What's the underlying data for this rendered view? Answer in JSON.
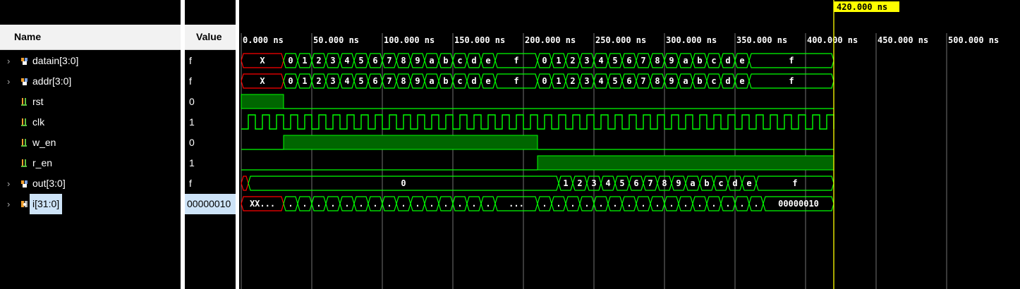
{
  "columns": {
    "name": "Name",
    "value": "Value"
  },
  "signals": [
    {
      "name": "datain[3:0]",
      "value": "f",
      "kind": "bus",
      "icon": "bus-icon"
    },
    {
      "name": "addr[3:0]",
      "value": "f",
      "kind": "bus",
      "icon": "bus-icon"
    },
    {
      "name": "rst",
      "value": "0",
      "kind": "bit",
      "icon": "bit-icon"
    },
    {
      "name": "clk",
      "value": "1",
      "kind": "bit",
      "icon": "bit-icon"
    },
    {
      "name": "w_en",
      "value": "0",
      "kind": "bit",
      "icon": "bit-icon"
    },
    {
      "name": "r_en",
      "value": "1",
      "kind": "bit",
      "icon": "bit-icon"
    },
    {
      "name": "out[3:0]",
      "value": "f",
      "kind": "bus",
      "icon": "bus-icon"
    },
    {
      "name": "i[31:0]",
      "value": "00000010",
      "kind": "bus",
      "icon": "integer-icon",
      "selected": true
    }
  ],
  "timeline": {
    "tick_labels": [
      "0.000 ns",
      "50.000 ns",
      "100.000 ns",
      "150.000 ns",
      "200.000 ns",
      "250.000 ns",
      "300.000 ns",
      "350.000 ns",
      "400.000 ns",
      "450.000 ns",
      "500.000 ns"
    ],
    "cursor_label": "420.000 ns",
    "cursor_time_ns": 420
  },
  "waves": {
    "datain": [
      "X",
      "0",
      "1",
      "2",
      "3",
      "4",
      "5",
      "6",
      "7",
      "8",
      "9",
      "a",
      "b",
      "c",
      "d",
      "e",
      "f",
      "0",
      "1",
      "2",
      "3",
      "4",
      "5",
      "6",
      "7",
      "8",
      "9",
      "a",
      "b",
      "c",
      "d",
      "e",
      "f"
    ],
    "addr": [
      "X",
      "0",
      "1",
      "2",
      "3",
      "4",
      "5",
      "6",
      "7",
      "8",
      "9",
      "a",
      "b",
      "c",
      "d",
      "e",
      "f",
      "0",
      "1",
      "2",
      "3",
      "4",
      "5",
      "6",
      "7",
      "8",
      "9",
      "a",
      "b",
      "c",
      "d",
      "e",
      "f"
    ],
    "out": [
      "0",
      "1",
      "2",
      "3",
      "4",
      "5",
      "6",
      "7",
      "8",
      "9",
      "a",
      "b",
      "c",
      "d",
      "e",
      "f"
    ],
    "i_first": "XX...",
    "i_mid": "...",
    "i_dot": ".",
    "i_last": "00000010"
  },
  "colors": {
    "wave": "#00ff00",
    "fill": "#006600",
    "unknown": "#ff0000",
    "cursor": "#ffff00",
    "grid": "#ffffff"
  }
}
